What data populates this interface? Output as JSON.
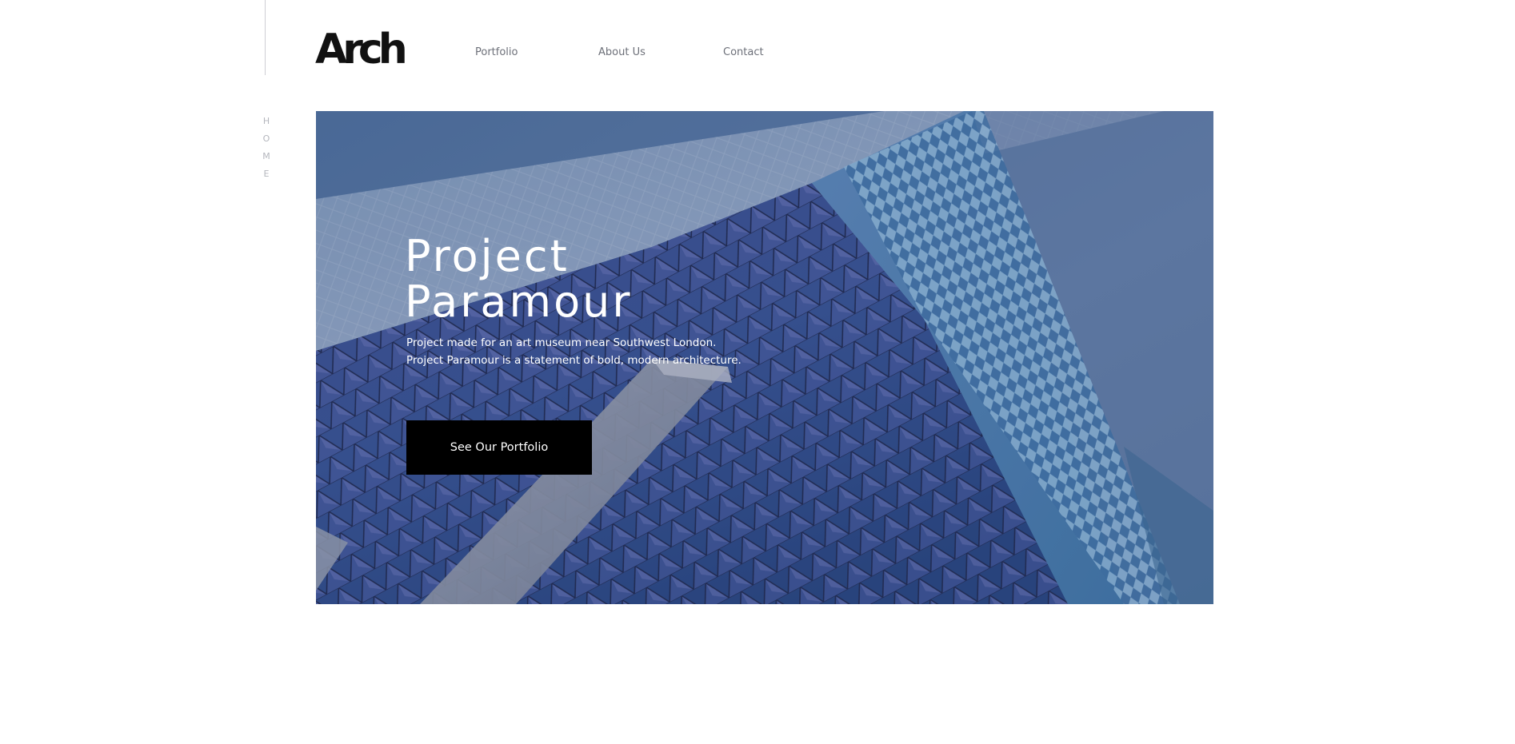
{
  "brand": {
    "logo_text": "Arch"
  },
  "nav": {
    "items": [
      {
        "label": "Portfolio"
      },
      {
        "label": "About Us"
      },
      {
        "label": "Contact"
      }
    ]
  },
  "sidebar": {
    "label_letters": [
      "H",
      "O",
      "M",
      "E"
    ]
  },
  "hero": {
    "title_line_1": "Project",
    "title_line_2": "Paramour",
    "description_line_1": "Project made for an art museum near Southwest London.",
    "description_line_2": "Project Paramour is a statement of bold, modern architecture.",
    "cta_label": "See Our Portfolio"
  },
  "colors": {
    "background": "#ffffff",
    "logo": "#111111",
    "nav_text": "#6d7079",
    "side_label": "#b4b6bd",
    "hero_text": "#ffffff",
    "cta_background": "#000000",
    "cta_text": "#ffffff"
  }
}
